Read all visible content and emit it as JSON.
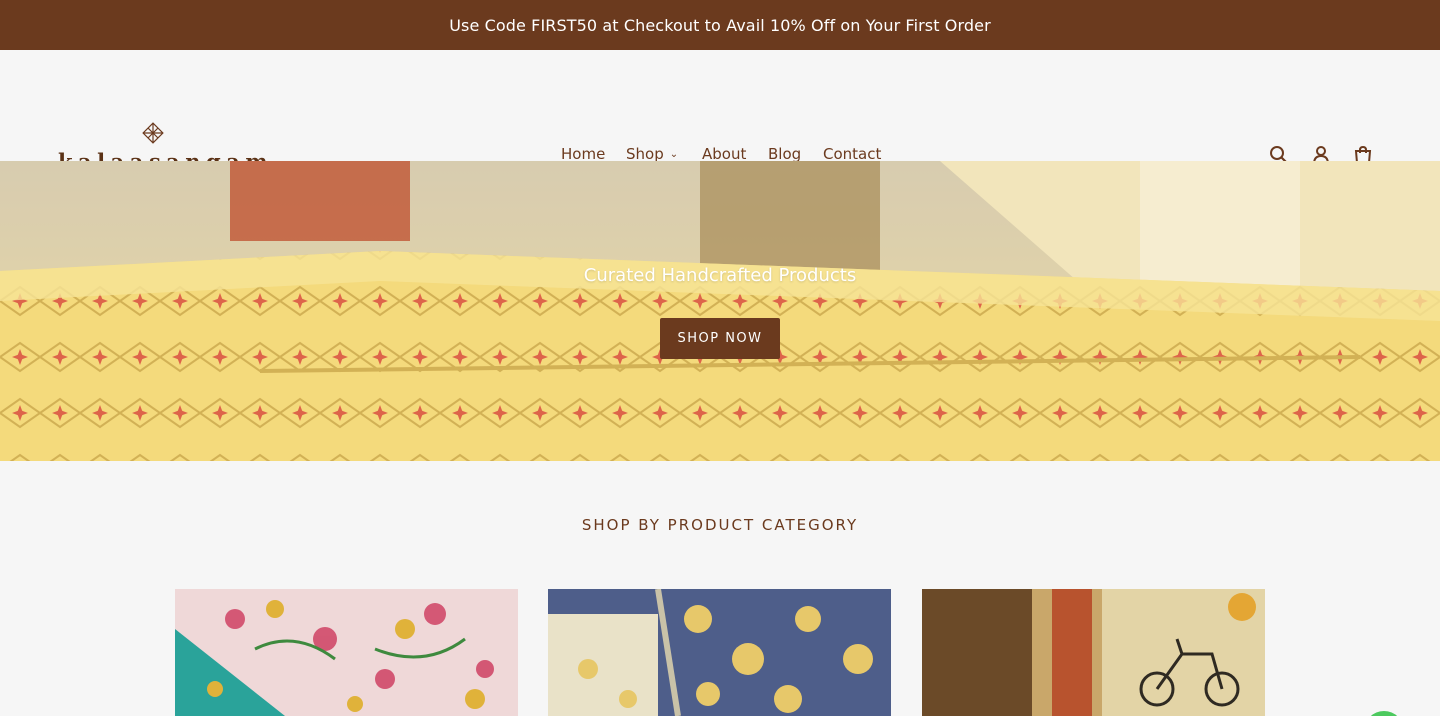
{
  "announcement": {
    "text": "Use Code FIRST50 at Checkout to Avail 10% Off on Your First Order"
  },
  "brand": {
    "name": "kalaasangam",
    "color": "#6b3a1e"
  },
  "nav": {
    "items": [
      {
        "label": "Home",
        "active": true
      },
      {
        "label": "Shop",
        "has_dropdown": true
      },
      {
        "label": "About"
      },
      {
        "label": "Blog"
      },
      {
        "label": "Contact"
      }
    ]
  },
  "header_icons": [
    "search-icon",
    "account-icon",
    "cart-icon"
  ],
  "hero": {
    "title": "Curated Handcrafted Products",
    "button_label": "SHOP NOW"
  },
  "section": {
    "title": "SHOP BY PRODUCT CATEGORY"
  },
  "colors": {
    "accent": "#6b3a1e",
    "background": "#f6f6f6",
    "whatsapp": "#4cc95e"
  }
}
